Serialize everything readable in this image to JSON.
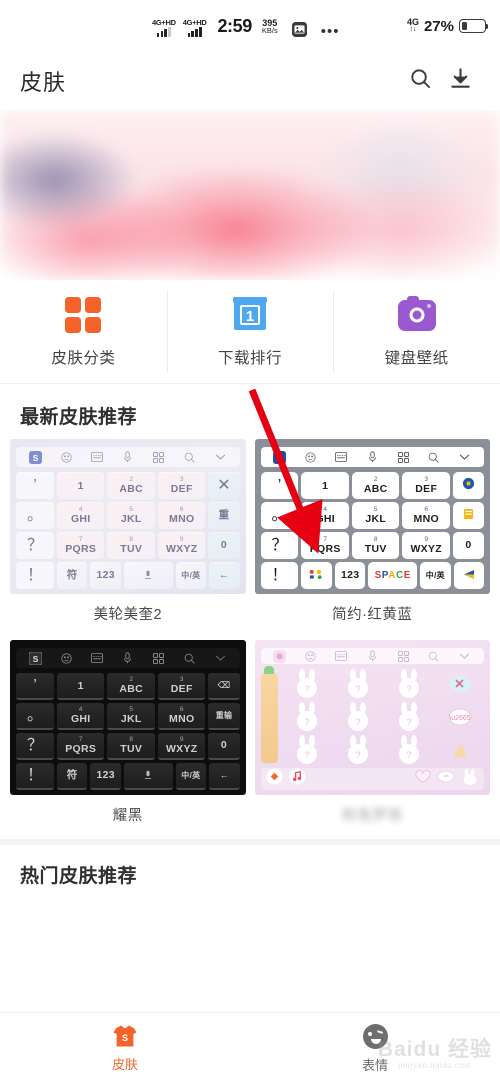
{
  "status_bar": {
    "signal_left_tag": "4G+HD",
    "signal_right_tag": "4G+HD",
    "time": "2:59",
    "net_speed_value": "395",
    "net_speed_unit": "KB/s",
    "overflow_dots": "•••",
    "right_net_tag": "4G",
    "right_net_arrows": "↑↓",
    "battery_percent": "27%",
    "app_icon": "photo-icon"
  },
  "header": {
    "title": "皮肤",
    "search_icon": "search-icon",
    "download_icon": "download-icon"
  },
  "banner": {
    "alt": "blurred-pink-promo-banner"
  },
  "categories": [
    {
      "label": "皮肤分类",
      "icon": "grid-icon",
      "color": "#f4642a"
    },
    {
      "label": "下载排行",
      "icon": "ribbon-icon",
      "color": "#4ea8ef",
      "badge": "1"
    },
    {
      "label": "键盘壁纸",
      "icon": "camera-icon",
      "color": "#9b59d0"
    }
  ],
  "sections": {
    "latest_title": "最新皮肤推荐",
    "hot_title": "热门皮肤推荐"
  },
  "skins": [
    {
      "name": "美轮美奎2",
      "theme": "pastel",
      "blurred": false
    },
    {
      "name": "简约·红黄蓝",
      "theme": "gray-white",
      "blurred": false
    },
    {
      "name": "耀黑",
      "theme": "dark",
      "blurred": false
    },
    {
      "name": "粉兔梦境",
      "theme": "pink-rabbit",
      "blurred": true
    }
  ],
  "keyboard_mock": {
    "toolbar_icons": [
      "sogou-logo-icon",
      "emoji-icon",
      "keyboard-icon",
      "microphone-icon",
      "apps-grid-icon",
      "search-icon",
      "chevron-down-icon"
    ],
    "left_column": [
      "’",
      "。",
      "？",
      "！"
    ],
    "keys": [
      {
        "sup": "",
        "main": "1"
      },
      {
        "sup": "2",
        "main": "ABC"
      },
      {
        "sup": "3",
        "main": "DEF"
      },
      {
        "sup": "4",
        "main": "GHI"
      },
      {
        "sup": "5",
        "main": "JKL"
      },
      {
        "sup": "6",
        "main": "MNO"
      },
      {
        "sup": "7",
        "main": "PQRS"
      },
      {
        "sup": "8",
        "main": "TUV"
      },
      {
        "sup": "9",
        "main": "WXYZ"
      }
    ],
    "right_column_1": [
      "✕",
      "重",
      "0"
    ],
    "right_column_3": [
      "⌫",
      "重输",
      "0"
    ],
    "bottom_row": [
      "符",
      "123",
      "空格",
      "中/英",
      "←"
    ],
    "space_label_colored": "SPACE"
  },
  "annotation": {
    "type": "red-arrow",
    "points_to": "下载排行 → skin 简约·红黄蓝 key 1",
    "color": "#e60012"
  },
  "tabbar": [
    {
      "label": "皮肤",
      "icon": "shirt-icon",
      "active": true,
      "color": "#f4642a"
    },
    {
      "label": "表情",
      "icon": "emoji-face-icon",
      "active": false,
      "color": "#6d6d6d"
    }
  ],
  "watermark": {
    "big": "Baidu 经验",
    "small": "jingyan.baidu.com"
  }
}
